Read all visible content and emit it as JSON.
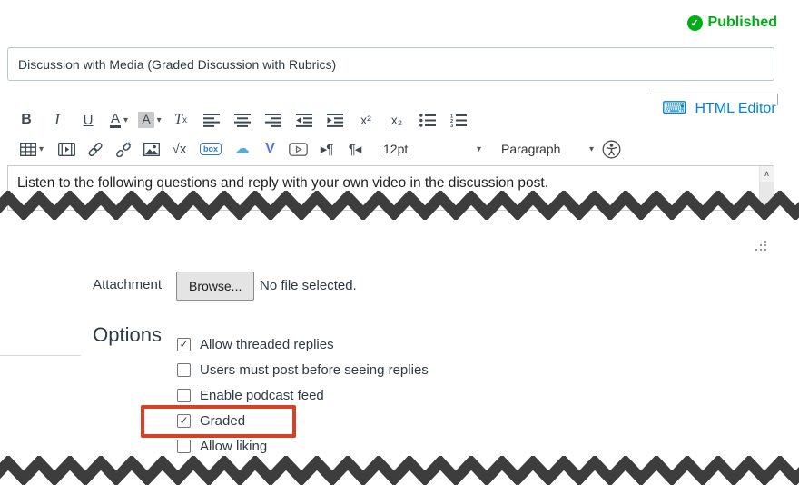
{
  "status": {
    "label": "Published"
  },
  "title_input": {
    "value": "Discussion with Media (Graded Discussion with Rubrics)"
  },
  "editor": {
    "html_editor_link": "HTML Editor",
    "toolbar": {
      "bold": "B",
      "italic": "I",
      "underline": "U",
      "text_color": "A",
      "background_color": "A",
      "clear_main": "T",
      "clear_sub": "x",
      "superscript": "x²",
      "subscript": "x₂",
      "equation": "√x",
      "box_label": "box",
      "v_label": "V",
      "ltr_glyph": "▸¶",
      "rtl_glyph": "¶◂",
      "font_size_value": "12pt",
      "paragraph_value": "Paragraph"
    },
    "content": "Listen to the following questions and reply with your own video in the discussion post."
  },
  "attachment": {
    "label": "Attachment",
    "browse_button": "Browse...",
    "file_status": "No file selected."
  },
  "options": {
    "heading": "Options",
    "checkboxes": [
      {
        "label": "Allow threaded replies",
        "checked": true,
        "mark": "✓",
        "highlighted": false
      },
      {
        "label": "Users must post before seeing replies",
        "checked": false,
        "mark": "",
        "highlighted": false
      },
      {
        "label": "Enable podcast feed",
        "checked": false,
        "mark": "",
        "highlighted": false
      },
      {
        "label": "Graded",
        "checked": true,
        "mark": "✓",
        "highlighted": true
      },
      {
        "label": "Allow liking",
        "checked": false,
        "mark": "",
        "highlighted": false
      }
    ]
  },
  "icons": {
    "check_icon": "✓",
    "keyboard_icon": "⌨",
    "caret_down_icon": "▾",
    "cloud_icon": "☁",
    "scroll_up_icon": "∧"
  },
  "colors": {
    "published_green": "#00AC18",
    "link_blue": "#0084D1",
    "annotation_red": "#D64027",
    "text": "#2D3B45",
    "input_border": "#B9C6D0"
  }
}
